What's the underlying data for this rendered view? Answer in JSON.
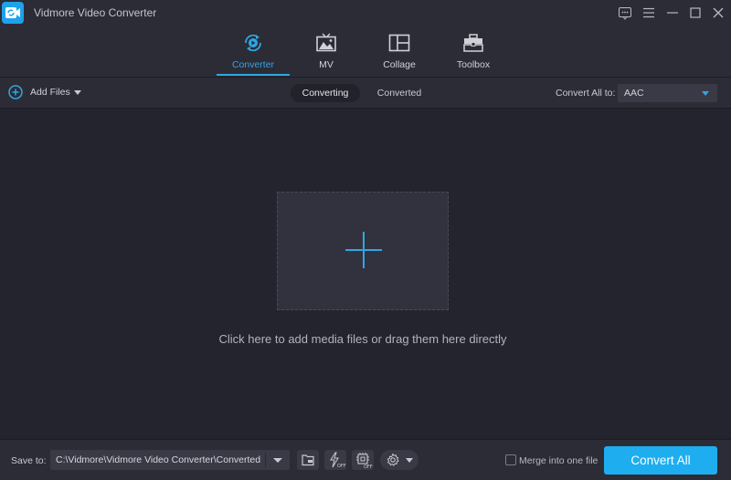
{
  "window": {
    "title": "Vidmore Video Converter",
    "controls": [
      {
        "name": "feedback",
        "icon": "chat-bubble-icon"
      },
      {
        "name": "menu",
        "icon": "hamburger-menu-icon"
      },
      {
        "name": "minimize",
        "icon": "minimize-icon"
      },
      {
        "name": "maximize",
        "icon": "maximize-icon"
      },
      {
        "name": "close",
        "icon": "close-icon"
      }
    ]
  },
  "nav": {
    "tabs": [
      {
        "label": "Converter",
        "icon": "converter-icon",
        "active": true
      },
      {
        "label": "MV",
        "icon": "tv-image-icon",
        "active": false
      },
      {
        "label": "Collage",
        "icon": "collage-layout-icon",
        "active": false
      },
      {
        "label": "Toolbox",
        "icon": "toolbox-icon",
        "active": false
      }
    ]
  },
  "toolbar": {
    "add_files_label": "Add Files",
    "segments": [
      {
        "label": "Converting",
        "active": true
      },
      {
        "label": "Converted",
        "active": false
      }
    ],
    "convert_all_to_label": "Convert All to:",
    "format_value": "AAC"
  },
  "main": {
    "drop_hint": "Click here to add media files or drag them here directly"
  },
  "bottom": {
    "save_to_label": "Save to:",
    "save_path": "C:\\Vidmore\\Vidmore Video Converter\\Converted",
    "tools": [
      {
        "name": "open-folder",
        "icon": "folder-icon"
      },
      {
        "name": "hardware-acceleration",
        "icon": "lightning-off-icon",
        "badge": "OFF"
      },
      {
        "name": "gpu-acceleration",
        "icon": "cpu-off-icon",
        "badge": "OFF"
      },
      {
        "name": "settings",
        "icon": "gear-icon"
      }
    ],
    "merge_label": "Merge into one file",
    "merge_checked": false,
    "convert_all_label": "Convert All"
  },
  "colors": {
    "accent": "#2fa7e3",
    "button": "#1eaef0",
    "background": "#24242e",
    "panel": "#2c2c36"
  }
}
